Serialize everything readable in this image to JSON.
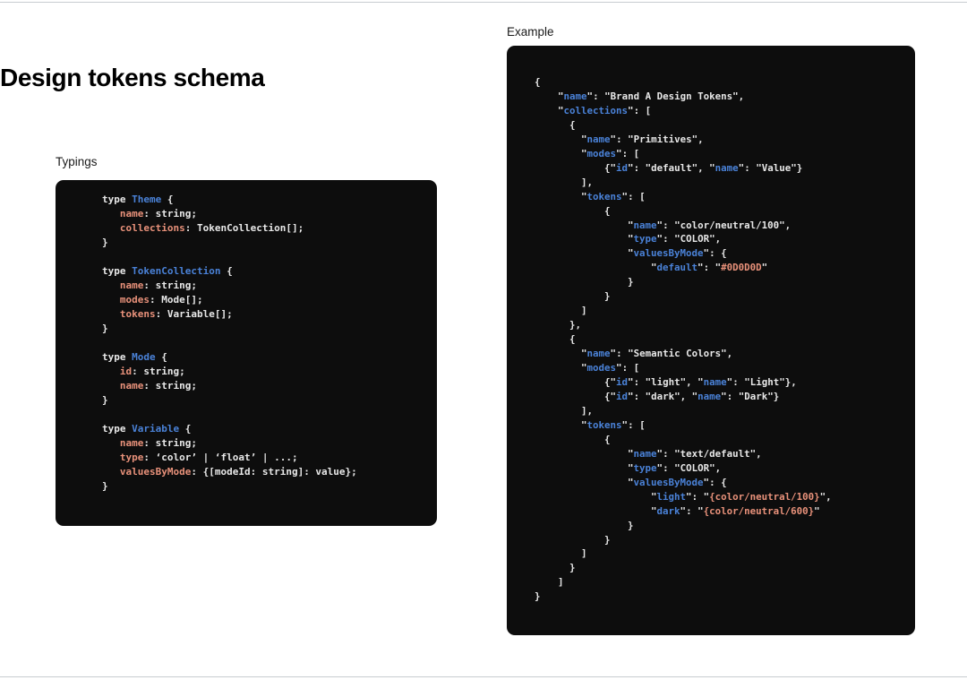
{
  "page": {
    "title": "Design tokens schema",
    "background_color": "#ffffff",
    "rule_color": "#c8ccd0"
  },
  "theme": {
    "code_background": "#0d0d0d",
    "code_foreground": "#e8e8e8",
    "type_color": "#4a82d8",
    "property_color": "#e8917a",
    "key_color": "#4a82d8",
    "value_color": "#e8917a"
  },
  "panels": {
    "typings": {
      "label": "Typings",
      "code": "type Theme {\n   name: string;\n   collections: TokenCollection[];\n}\n\ntype TokenCollection {\n   name: string;\n   modes: Mode[];\n   tokens: Variable[];\n}\n\ntype Mode {\n   id: string;\n   name: string;\n}\n\ntype Variable {\n   name: string;\n   type: ‘color’ | ‘float’ | ...;\n   valuesByMode: {[modeId: string]: value};\n}",
      "types": [
        {
          "name": "Theme",
          "fields": [
            {
              "name": "name",
              "type": "string;"
            },
            {
              "name": "collections",
              "type": "TokenCollection[];"
            }
          ]
        },
        {
          "name": "TokenCollection",
          "fields": [
            {
              "name": "name",
              "type": "string;"
            },
            {
              "name": "modes",
              "type": "Mode[];"
            },
            {
              "name": "tokens",
              "type": "Variable[];"
            }
          ]
        },
        {
          "name": "Mode",
          "fields": [
            {
              "name": "id",
              "type": "string;"
            },
            {
              "name": "name",
              "type": "string;"
            }
          ]
        },
        {
          "name": "Variable",
          "fields": [
            {
              "name": "name",
              "type": "string;"
            },
            {
              "name": "type",
              "type": "‘color’ | ‘float’ | ...;"
            },
            {
              "name": "valuesByMode",
              "type": "{[modeId: string]: value};"
            }
          ]
        }
      ],
      "keyword": "type",
      "brace_open": "{",
      "brace_close": "}"
    },
    "example": {
      "label": "Example",
      "code": "{\n    \"name\": \"Brand A Design Tokens\",\n    \"collections\": [\n      {\n        \"name\": \"Primitives\",\n        \"modes\": [\n            {\"id\": \"default\", \"name\": \"Value\"}\n        ],\n        \"tokens\": [\n            {\n                \"name\": \"color/neutral/100\",\n                \"type\": \"COLOR\",\n                \"valuesByMode\": {\n                    \"default\": \"#0D0D0D\"\n                }\n            }\n        ]\n      },\n      {\n        \"name\": \"Semantic Colors\",\n        \"modes\": [\n            {\"id\": \"light\", \"name\": \"Light\"},\n            {\"id\": \"dark\", \"name\": \"Dark\"}\n        ],\n        \"tokens\": [\n            {\n                \"name\": \"text/default\",\n                \"type\": \"COLOR\",\n                \"valuesByMode\": {\n                    \"light\": \"{color/neutral/100}\",\n                    \"dark\": \"{color/neutral/600}\"\n                }\n            }\n        ]\n      }\n    ]\n}",
      "json": {
        "name": "Brand A Design Tokens",
        "collections": [
          {
            "name": "Primitives",
            "modes": [
              {
                "id": "default",
                "name": "Value"
              }
            ],
            "tokens": [
              {
                "name": "color/neutral/100",
                "type": "COLOR",
                "valuesByMode": {
                  "default": "#0D0D0D"
                }
              }
            ]
          },
          {
            "name": "Semantic Colors",
            "modes": [
              {
                "id": "light",
                "name": "Light"
              },
              {
                "id": "dark",
                "name": "Dark"
              }
            ],
            "tokens": [
              {
                "name": "text/default",
                "type": "COLOR",
                "valuesByMode": {
                  "light": "{color/neutral/100}",
                  "dark": "{color/neutral/600}"
                }
              }
            ]
          }
        ]
      }
    }
  }
}
